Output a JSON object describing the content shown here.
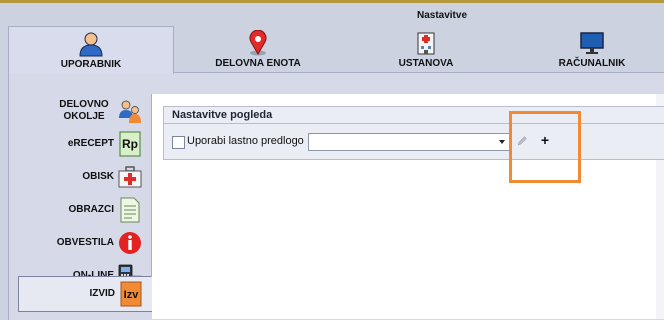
{
  "window": {
    "title": "Nastavitve"
  },
  "tabs": [
    {
      "label": "UPORABNIK",
      "icon": "user-icon",
      "active": true
    },
    {
      "label": "DELOVNA ENOTA",
      "icon": "map-pin-icon",
      "active": false
    },
    {
      "label": "USTANOVA",
      "icon": "hospital-icon",
      "active": false
    },
    {
      "label": "RAČUNALNIK",
      "icon": "monitor-icon",
      "active": false
    }
  ],
  "sidebar": {
    "items": [
      {
        "label": "DELOVNO OKOLJE",
        "icon": "people-icon",
        "active": false
      },
      {
        "label": "eRECEPT",
        "icon": "rp-prescription-icon",
        "active": false
      },
      {
        "label": "OBISK",
        "icon": "medkit-icon",
        "active": false
      },
      {
        "label": "OBRAZCI",
        "icon": "forms-icon",
        "active": false
      },
      {
        "label": "OBVESTILA",
        "icon": "info-icon",
        "active": false
      },
      {
        "label": "ON-LINE",
        "icon": "card-reader-icon",
        "active": false
      },
      {
        "label": "IZVID",
        "icon": "izv-report-icon",
        "active": true
      }
    ]
  },
  "main": {
    "group_title": "Nastavitve pogleda",
    "checkbox_label": "Uporabi lastno predlogo",
    "checkbox_checked": false,
    "template_select_value": "",
    "edit_button_icon": "pencil-icon",
    "add_button_label": "+"
  },
  "colors": {
    "highlight": "#f08a35",
    "background": "#cdd2e1"
  }
}
